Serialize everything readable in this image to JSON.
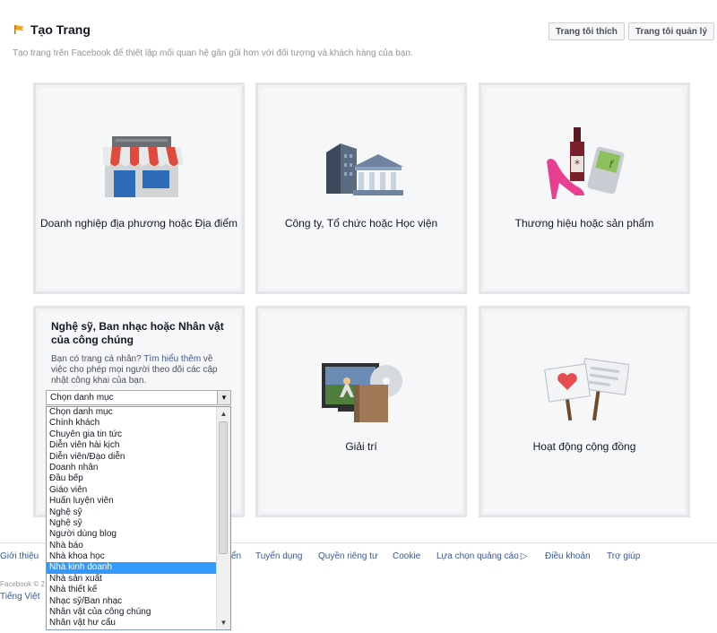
{
  "header": {
    "title": "Tạo Trang",
    "subtitle": "Tạo trang trên Facebook để thiết lập mối quan hệ gần gũi hơn với đối tượng và khách hàng của bạn.",
    "liked_pages_label": "Trang tôi thích",
    "managed_pages_label": "Trang tôi quản lý"
  },
  "tiles": [
    {
      "label": "Doanh nghiệp địa phương hoặc Địa điểm",
      "icon": "storefront-icon"
    },
    {
      "label": "Công ty, Tổ chức hoặc Học viện",
      "icon": "company-building-icon"
    },
    {
      "label": "Thương hiệu hoặc sản phẩm",
      "icon": "brand-products-icon"
    },
    {
      "label": "Giải trí",
      "icon": "entertainment-icon"
    },
    {
      "label": "Hoạt động cộng đồng",
      "icon": "community-signs-icon"
    }
  ],
  "artist_tile": {
    "title": "Nghệ sỹ, Ban nhạc hoặc Nhân vật của công chúng",
    "desc_before": "Bạn có trang cá nhân? ",
    "learn_more": "Tìm hiểu thêm",
    "desc_after": " về việc cho phép mọi người theo dõi các cập nhật công khai của bạn.",
    "select_value": "Chọn danh mục"
  },
  "dropdown": {
    "selected_index": 14,
    "options": [
      "Chọn danh mục",
      "Chính khách",
      "Chuyên gia tin tức",
      "Diễn viên hài kịch",
      "Diễn viên/Đạo diễn",
      "Doanh nhân",
      "Đầu bếp",
      "Giáo viên",
      "Huấn luyện viên",
      "Nghệ sỹ",
      "Nghệ sỹ",
      "Người dùng blog",
      "Nhà báo",
      "Nhà khoa học",
      "Nhà kinh doanh",
      "Nhà sản xuất",
      "Nhà thiết kế",
      "Nhạc sỹ/Ban nhạc",
      "Nhân vật của công chúng",
      "Nhân vật hư cấu"
    ]
  },
  "footer": {
    "links": [
      "Giới thiệu",
      "ển",
      "Tuyển dụng",
      "Quyền riêng tư",
      "Cookie",
      "Lựa chọn quảng cáo",
      "Điều khoản",
      "Trợ giúp"
    ],
    "copyright": "Facebook © 2",
    "language": "Tiếng Việt"
  }
}
